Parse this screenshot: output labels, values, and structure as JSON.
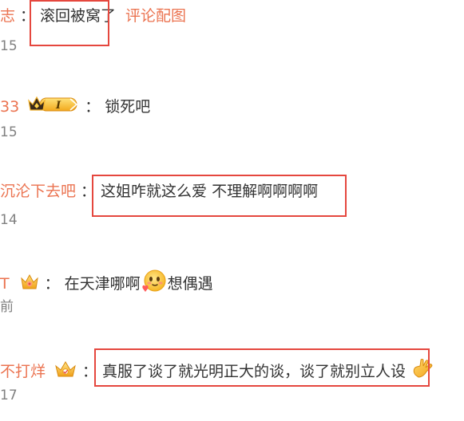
{
  "comments": [
    {
      "username": "志",
      "text": "滚回被窝了",
      "link": "评论配图",
      "time": "15"
    },
    {
      "username": "33",
      "text": "锁死吧",
      "time": "15"
    },
    {
      "username": "沉沦下去吧",
      "text": "这姐咋就这么爱 不理解啊啊啊啊",
      "time": "14"
    },
    {
      "username": "T",
      "text_before": "在天津哪啊",
      "text_after": "想偶遇",
      "time": "前"
    },
    {
      "username": "不打烊",
      "text": "真服了谈了就光明正大的谈，谈了就别立人设",
      "time": "17"
    }
  ],
  "colon": "：",
  "colors": {
    "username": "#eb7350",
    "text": "#333333",
    "time": "#808080",
    "highlight_box": "#e5473e"
  },
  "icons": [
    "crown-level-badge",
    "crown-badge",
    "blush-emoji",
    "crown-badge",
    "hand-emoji"
  ]
}
